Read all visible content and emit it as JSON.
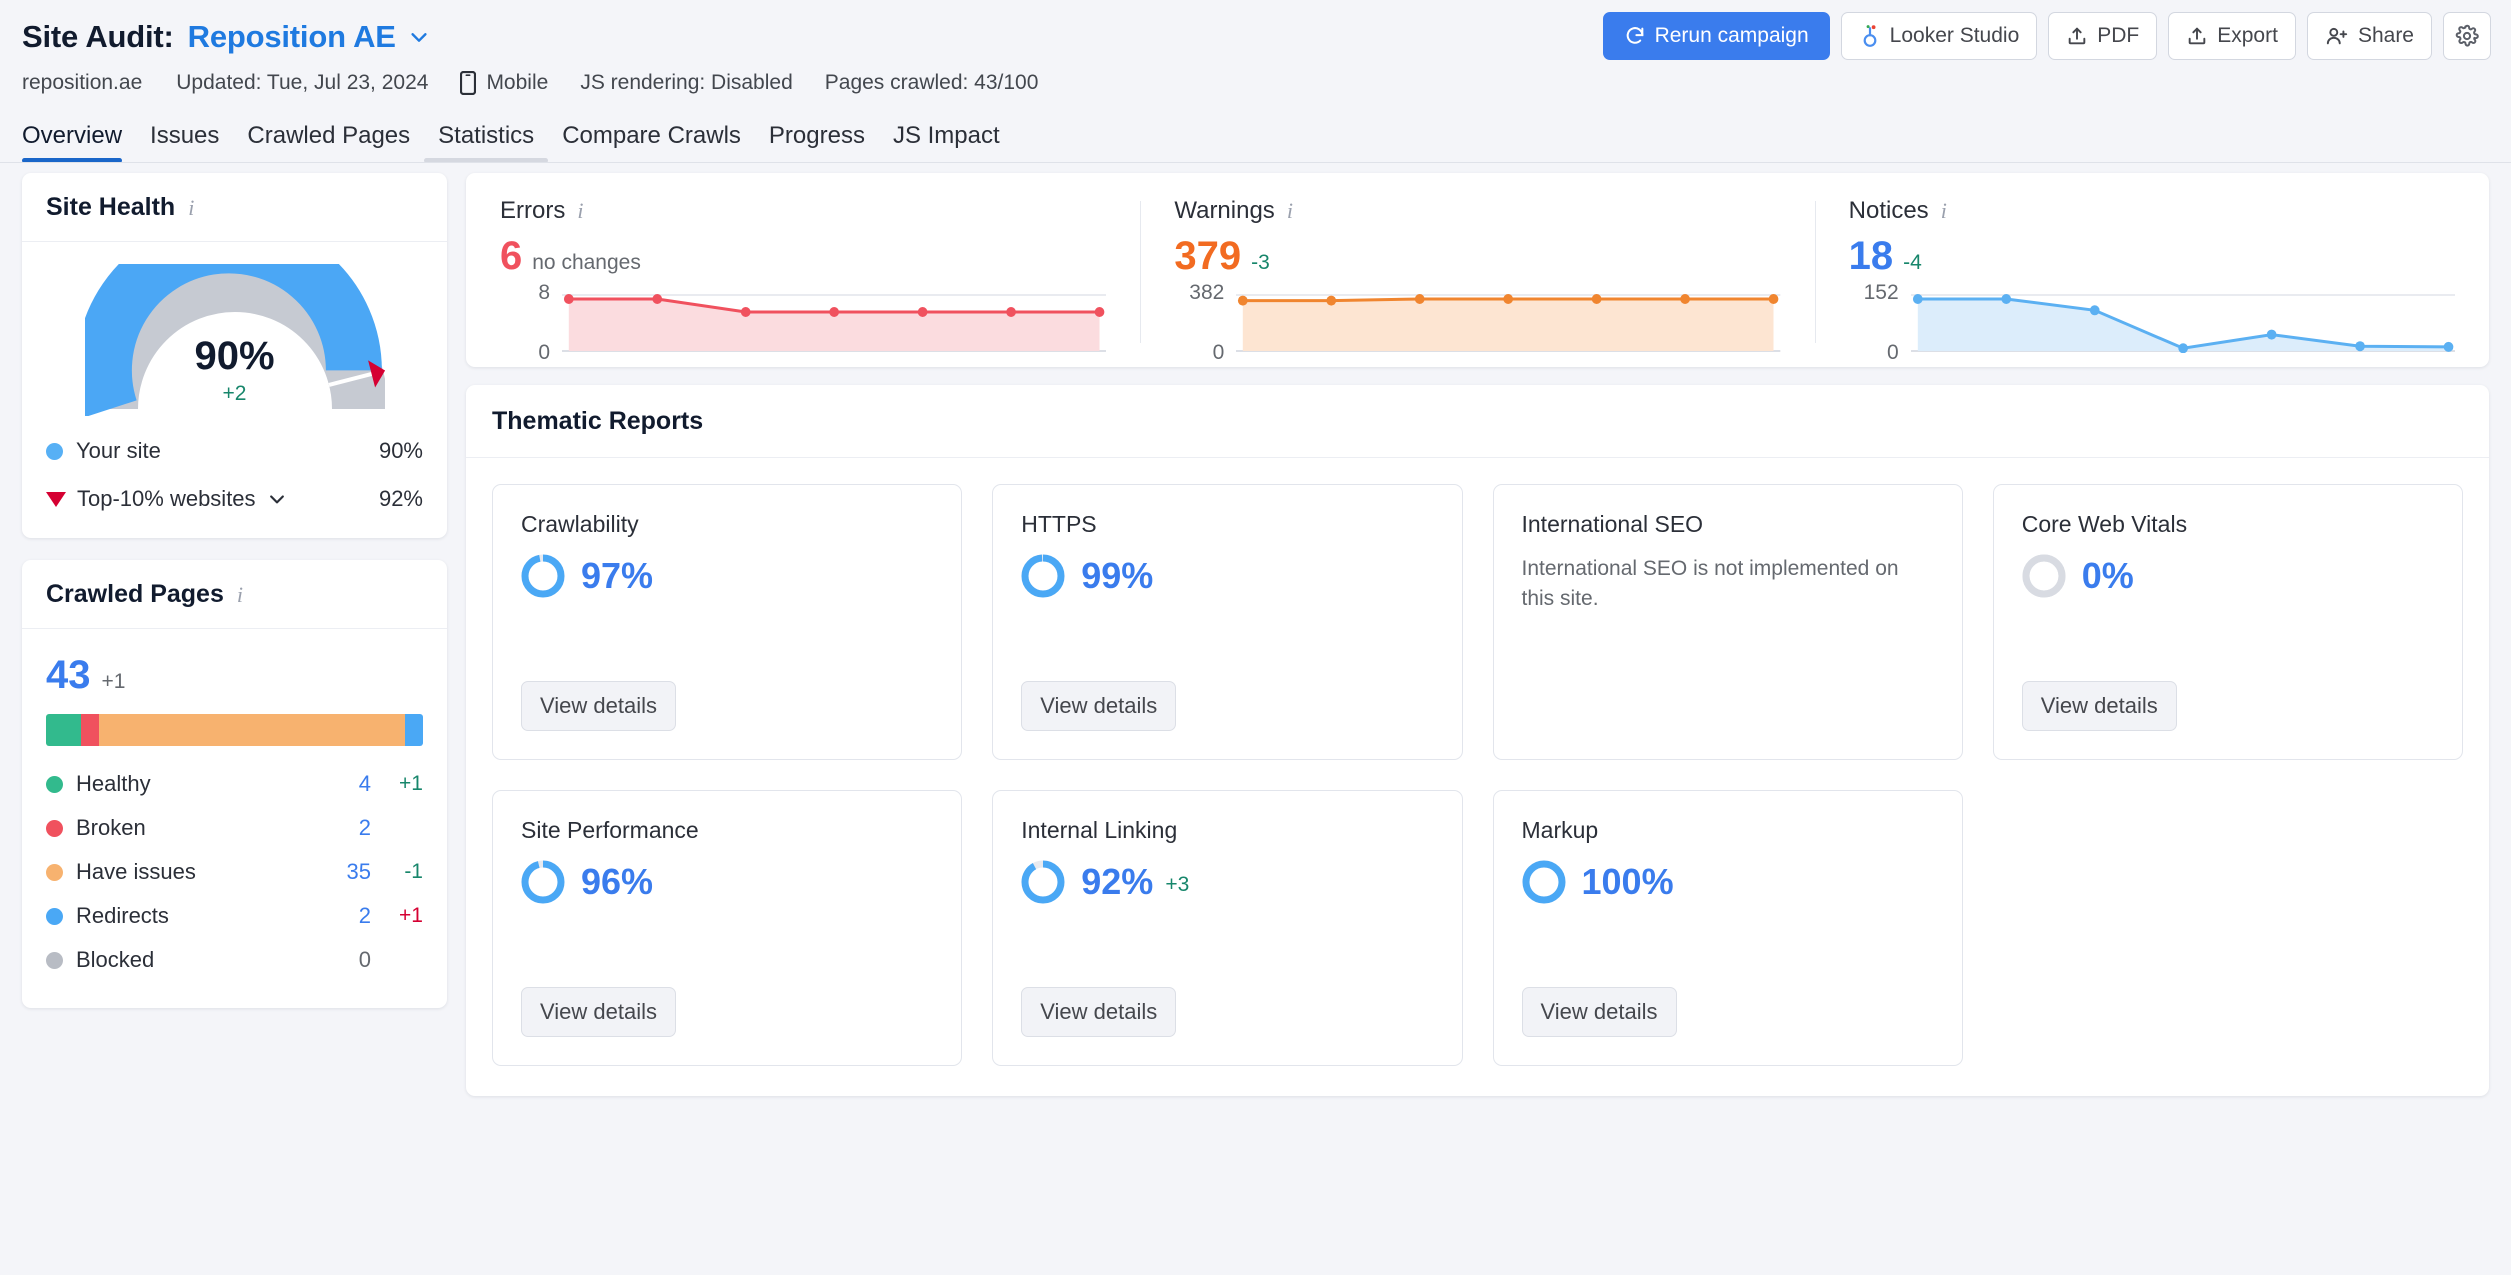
{
  "header": {
    "title_static": "Site Audit:",
    "project_name": "Reposition AE",
    "project_caret_icon": "chevron-down-icon",
    "meta": {
      "domain": "reposition.ae",
      "updated": "Updated: Tue, Jul 23, 2024",
      "device_icon": "mobile-phone-icon",
      "device": "Mobile",
      "js_rendering": "JS rendering: Disabled",
      "pages_crawled": "Pages crawled: 43/100"
    },
    "actions": {
      "rerun": "Rerun campaign",
      "rerun_icon": "refresh-icon",
      "looker": "Looker Studio",
      "looker_icon": "looker-studio-icon",
      "pdf": "PDF",
      "pdf_icon": "upload-icon",
      "export": "Export",
      "export_icon": "upload-icon",
      "share": "Share",
      "share_icon": "add-user-icon",
      "settings_icon": "gear-icon"
    }
  },
  "tabs": [
    {
      "label": "Overview",
      "state": "active"
    },
    {
      "label": "Issues",
      "state": ""
    },
    {
      "label": "Crawled Pages",
      "state": ""
    },
    {
      "label": "Statistics",
      "state": "hover"
    },
    {
      "label": "Compare Crawls",
      "state": ""
    },
    {
      "label": "Progress",
      "state": ""
    },
    {
      "label": "JS Impact",
      "state": ""
    }
  ],
  "site_health": {
    "title": "Site Health",
    "info_icon": "info-icon",
    "score": "90%",
    "delta": "+2",
    "legend": [
      {
        "label": "Your site",
        "value": "90%",
        "marker": "dot",
        "color": "#57b0f5"
      },
      {
        "label": "Top-10% websites",
        "value": "92%",
        "marker": "triangle",
        "color": "#d50032",
        "caret_icon": "chevron-down-icon"
      }
    ],
    "gauge": {
      "value": 90,
      "benchmark": 92,
      "arc_color": "#4ba7f5",
      "rest_color": "#c6cad2"
    }
  },
  "crawled_pages": {
    "title": "Crawled Pages",
    "info_icon": "info-icon",
    "total": "43",
    "total_delta": "+1",
    "segments": [
      {
        "label": "Healthy",
        "count": 4,
        "color": "#32ba8d"
      },
      {
        "label": "Broken",
        "count": 2,
        "color": "#f0515e"
      },
      {
        "label": "Have issues",
        "count": 35,
        "color": "#f7b26f"
      },
      {
        "label": "Redirects",
        "count": 2,
        "color": "#4aa8f5"
      },
      {
        "label": "Blocked",
        "count": 0,
        "color": "#b8bcc4"
      }
    ],
    "rows": [
      {
        "label": "Healthy",
        "count": "4",
        "change": "+1",
        "change_kind": "up",
        "color": "#32ba8d"
      },
      {
        "label": "Broken",
        "count": "2",
        "change": "",
        "change_kind": "",
        "color": "#f0515e"
      },
      {
        "label": "Have issues",
        "count": "35",
        "change": "-1",
        "change_kind": "down",
        "color": "#f7b26f"
      },
      {
        "label": "Redirects",
        "count": "2",
        "change": "+1",
        "change_kind": "bad",
        "color": "#4aa8f5"
      },
      {
        "label": "Blocked",
        "count": "0",
        "change": "",
        "change_kind": "",
        "color": "#b8bcc4"
      }
    ]
  },
  "stats": [
    {
      "name": "Errors",
      "info_icon": "info-icon",
      "value": "6",
      "value_color": "#f0515e",
      "sub": "no changes",
      "sub_kind": "gray",
      "y_top": "8",
      "y_bottom": "0"
    },
    {
      "name": "Warnings",
      "info_icon": "info-icon",
      "value": "379",
      "value_color": "#f26b21",
      "sub": "-3",
      "sub_kind": "green",
      "y_top": "382",
      "y_bottom": "0"
    },
    {
      "name": "Notices",
      "info_icon": "info-icon",
      "value": "18",
      "value_color": "#3a7ced",
      "sub": "-4",
      "sub_kind": "green",
      "y_top": "152",
      "y_bottom": "0"
    }
  ],
  "thematic": {
    "title": "Thematic Reports",
    "view_details_label": "View details",
    "cards": [
      {
        "name": "Crawlability",
        "score": "97%",
        "pct": 97,
        "delta": "",
        "note": "",
        "has_button": true
      },
      {
        "name": "HTTPS",
        "score": "99%",
        "pct": 99,
        "delta": "",
        "note": "",
        "has_button": true
      },
      {
        "name": "International SEO",
        "score": "",
        "pct": null,
        "delta": "",
        "note": "International SEO is not implemented on this site.",
        "has_button": false
      },
      {
        "name": "Core Web Vitals",
        "score": "0%",
        "pct": 0,
        "delta": "",
        "note": "",
        "has_button": true
      },
      {
        "name": "Site Performance",
        "score": "96%",
        "pct": 96,
        "delta": "",
        "note": "",
        "has_button": true
      },
      {
        "name": "Internal Linking",
        "score": "92%",
        "pct": 92,
        "delta": "+3",
        "note": "",
        "has_button": true
      },
      {
        "name": "Markup",
        "score": "100%",
        "pct": 100,
        "delta": "",
        "note": "",
        "has_button": true
      }
    ]
  },
  "chart_data": [
    {
      "type": "area",
      "title": "Errors",
      "x": [
        1,
        2,
        3,
        4,
        5,
        6,
        7
      ],
      "values": [
        8,
        8,
        6,
        6,
        6,
        6,
        6
      ],
      "ylim": [
        0,
        8
      ],
      "ytick_labels": [
        "0",
        "8"
      ],
      "line_color": "#f0515e",
      "fill_color": "#fbdcdf",
      "current": 6,
      "change_label": "no changes",
      "grid": true,
      "legend": "none"
    },
    {
      "type": "area",
      "title": "Warnings",
      "x": [
        1,
        2,
        3,
        4,
        5,
        6,
        7
      ],
      "values": [
        370,
        370,
        382,
        382,
        382,
        382,
        382
      ],
      "ylim": [
        0,
        382
      ],
      "ytick_labels": [
        "0",
        "382"
      ],
      "line_color": "#f0852f",
      "fill_color": "#fde5d2",
      "current": 379,
      "change_label": "-3",
      "grid": true,
      "legend": "none"
    },
    {
      "type": "area",
      "title": "Notices",
      "x": [
        1,
        2,
        3,
        4,
        5,
        6,
        7
      ],
      "values": [
        152,
        152,
        119,
        8,
        48,
        14,
        12
      ],
      "ylim": [
        0,
        152
      ],
      "ytick_labels": [
        "0",
        "152"
      ],
      "line_color": "#5bb0f2",
      "fill_color": "#dcedfb",
      "current": 18,
      "change_label": "-4",
      "grid": true,
      "legend": "none"
    },
    {
      "type": "pie",
      "title": "Site Health",
      "labels": [
        "Your site",
        "Top-10% websites"
      ],
      "values": [
        90,
        92
      ],
      "unit": "%",
      "center_label": "90%",
      "delta": "+2"
    },
    {
      "type": "bar",
      "title": "Crawled Pages",
      "categories": [
        "Healthy",
        "Broken",
        "Have issues",
        "Redirects",
        "Blocked"
      ],
      "values": [
        4,
        2,
        35,
        2,
        0
      ],
      "total": 43,
      "total_delta": "+1",
      "stacked": true
    }
  ]
}
